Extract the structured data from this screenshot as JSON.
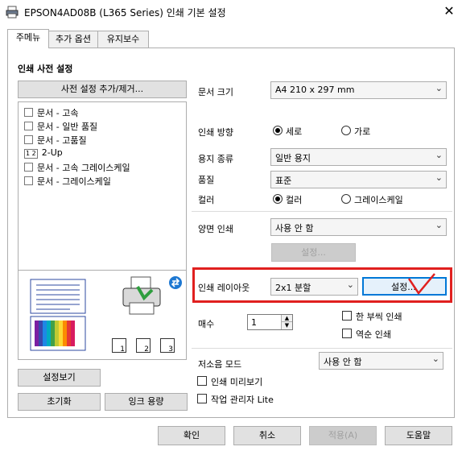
{
  "window": {
    "title": "EPSON4AD08B (L365 Series) 인쇄 기본 설정",
    "close": "✕"
  },
  "tabs": [
    "주메뉴",
    "추가 옵션",
    "유지보수"
  ],
  "presets": {
    "heading": "인쇄 사전 설정",
    "add_remove_button": "사전 설정 추가/제거...",
    "items": [
      "문서 - 고속",
      "문서 - 일반 품질",
      "문서 - 고품질",
      "2-Up",
      "문서 - 고속 그레이스케일",
      "문서 - 그레이스케일"
    ],
    "item_2up_prefix": "1 2"
  },
  "settings": {
    "paper_size": {
      "label": "문서 크기",
      "value": "A4 210 x 297 mm"
    },
    "orientation": {
      "label": "인쇄 방향",
      "options": [
        "세로",
        "가로"
      ],
      "selected": "세로"
    },
    "paper_type": {
      "label": "용지 종류",
      "value": "일반 용지"
    },
    "quality": {
      "label": "품질",
      "value": "표준"
    },
    "color": {
      "label": "컬러",
      "options": [
        "컬러",
        "그레이스케일"
      ],
      "selected": "컬러"
    },
    "duplex": {
      "label": "양면 인쇄",
      "value": "사용 안 함",
      "settings_button": "설정..."
    },
    "layout": {
      "label": "인쇄 레이아웃",
      "value": "2x1 분할",
      "settings_button": "설정..."
    },
    "copies": {
      "label": "매수",
      "value": "1"
    },
    "collate": {
      "label": "한 부씩 인쇄",
      "checked": false
    },
    "reverse": {
      "label": "역순 인쇄",
      "checked": false
    },
    "quiet_mode": {
      "label": "저소음 모드",
      "value": "사용 안 함"
    },
    "preview": {
      "label": "인쇄 미리보기",
      "checked": false
    },
    "job_arranger": {
      "label": "작업 관리자 Lite",
      "checked": false
    }
  },
  "left_buttons": {
    "show_settings": "설정보기",
    "reset": "초기화",
    "ink_levels": "잉크 용량"
  },
  "preview_pages": [
    "1",
    "2",
    "3"
  ],
  "footer": {
    "ok": "확인",
    "cancel": "취소",
    "apply": "적용(A)",
    "help": "도움말"
  },
  "colors": {
    "highlight_red": "#e0201f",
    "focus_blue": "#0078d7"
  }
}
